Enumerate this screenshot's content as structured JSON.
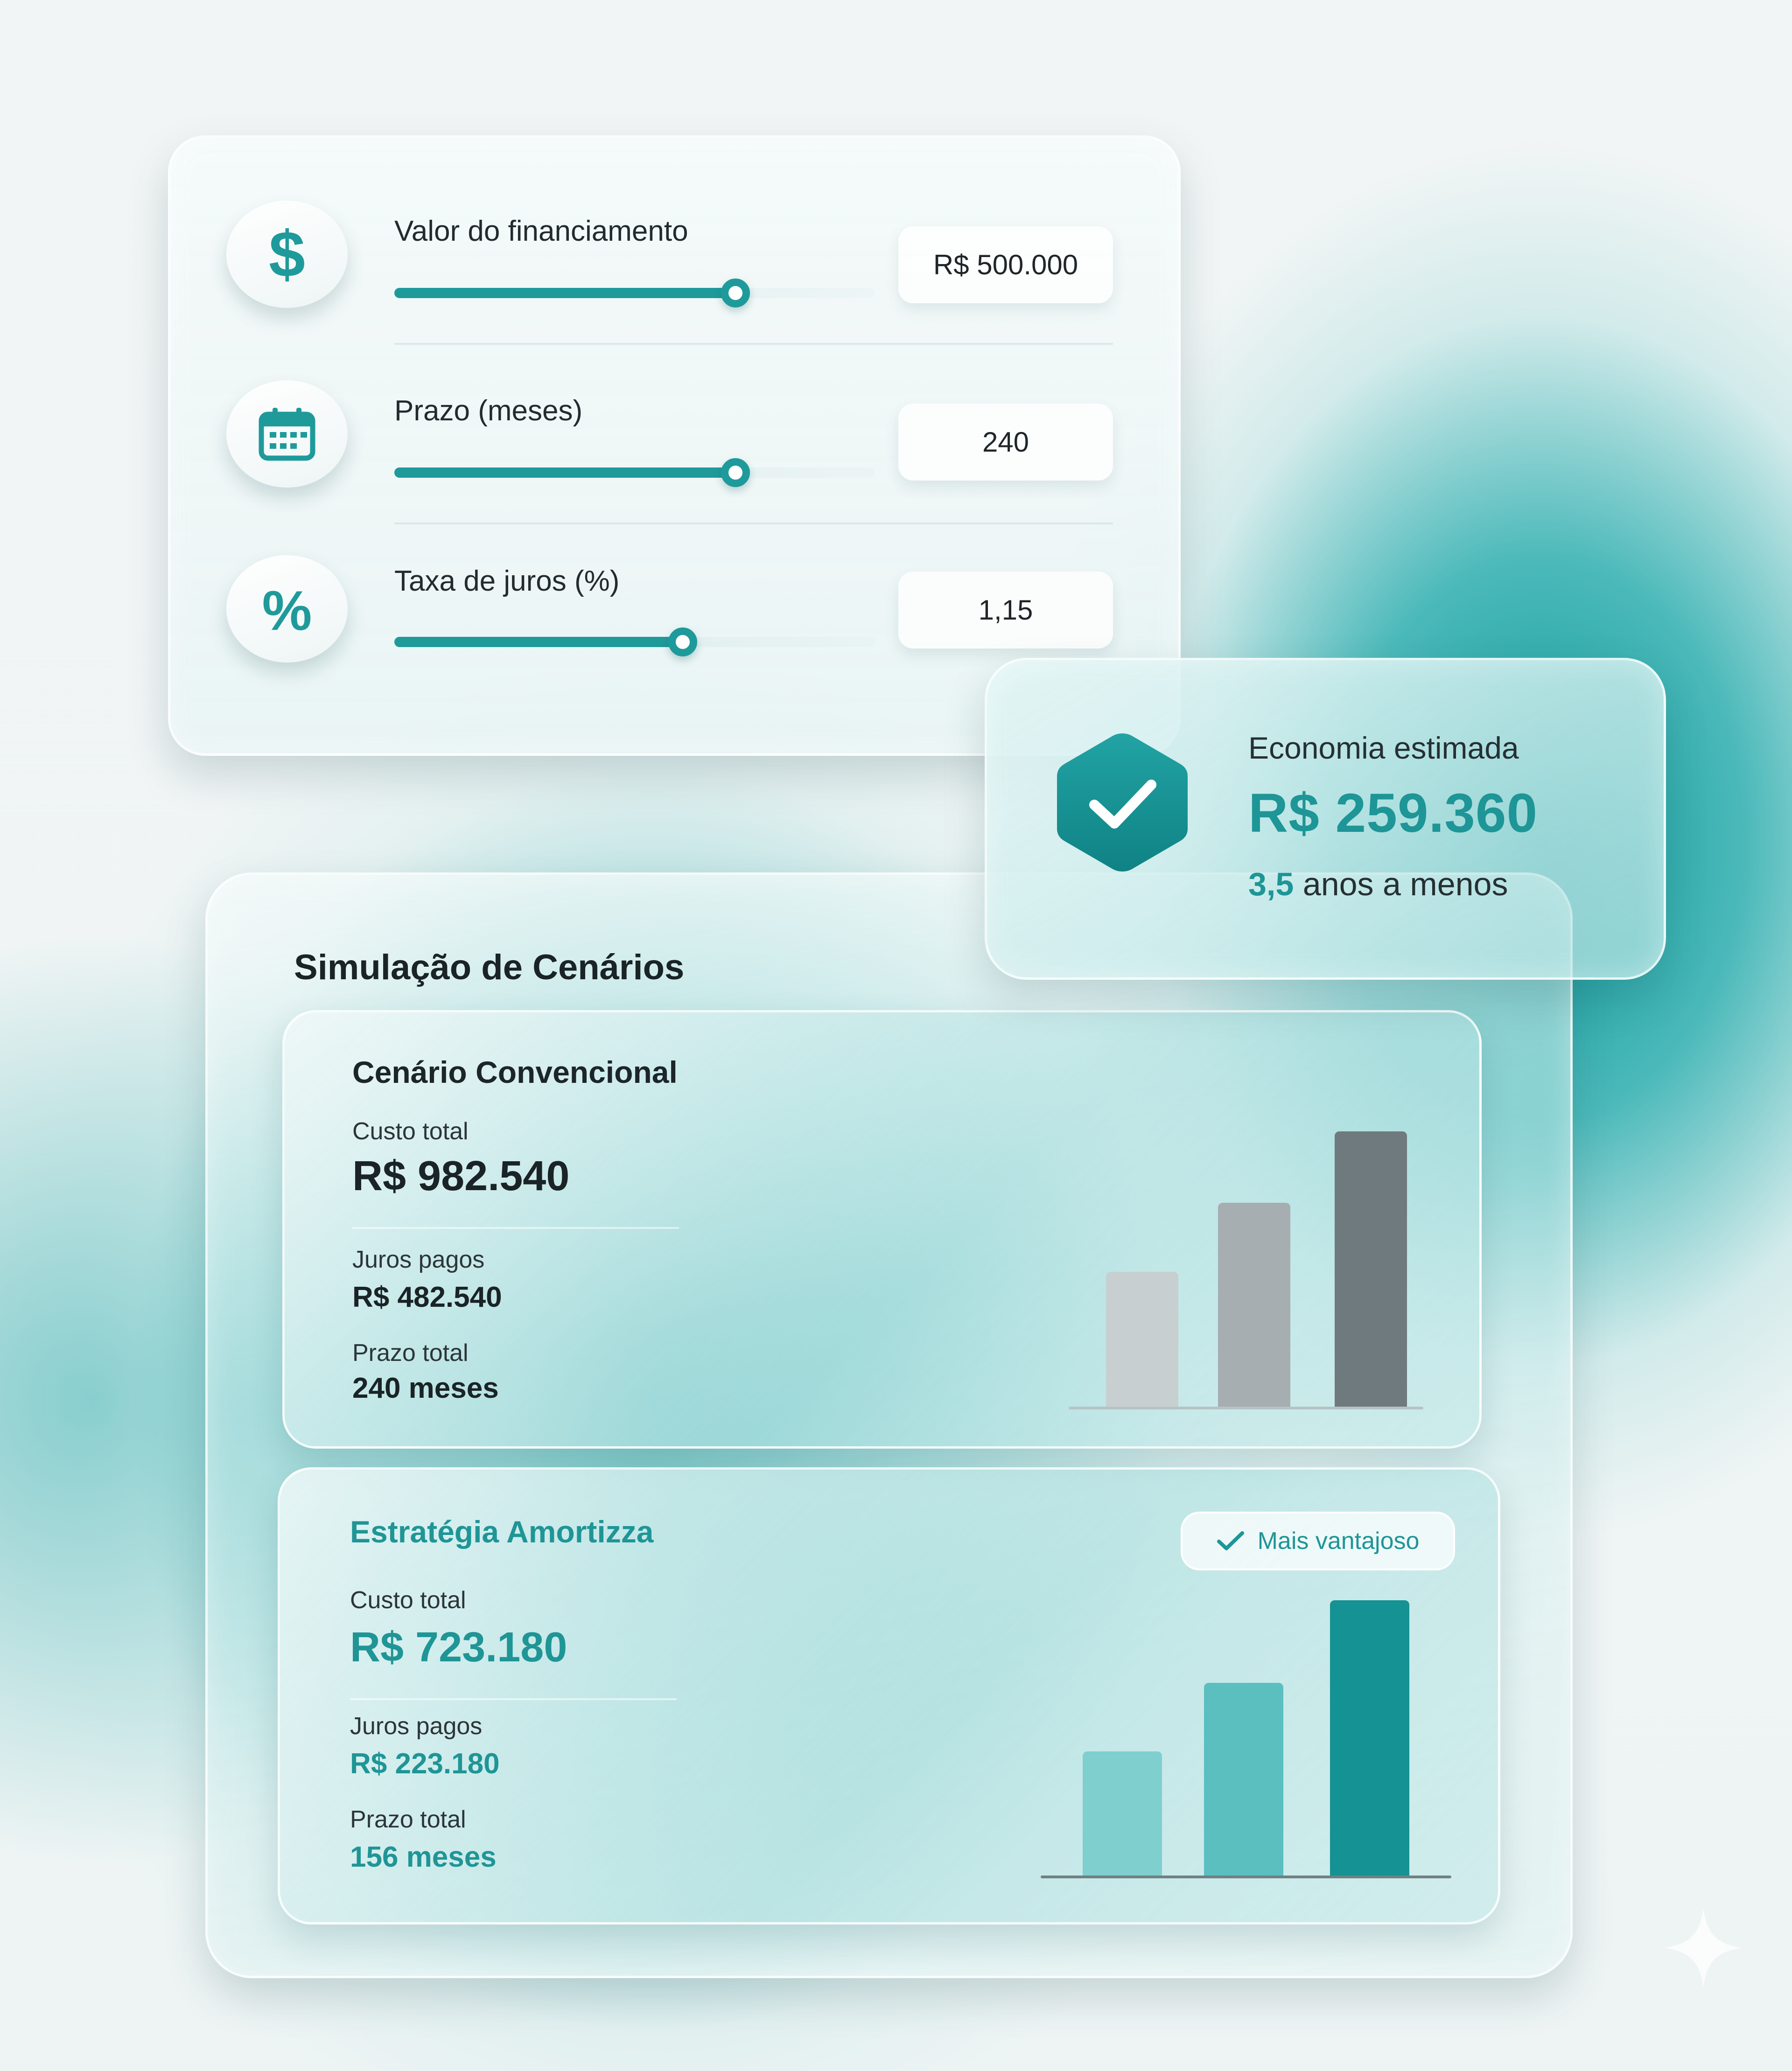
{
  "inputs": {
    "loan": {
      "label": "Valor do financiamento",
      "value": "R$ 500.000",
      "icon": "dollar-icon",
      "slider_fraction": 0.71
    },
    "term": {
      "label": "Prazo (meses)",
      "value": "240",
      "icon": "calendar-icon",
      "slider_fraction": 0.71
    },
    "rate": {
      "label": "Taxa de juros (%)",
      "value": "1,15",
      "icon": "percent-icon",
      "slider_fraction": 0.6
    }
  },
  "savings": {
    "label": "Economia estimada",
    "value": "R$ 259.360",
    "years": "3,5",
    "years_suffix": "anos a menos",
    "icon": "shield-check-icon"
  },
  "scenarios": {
    "title": "Simulação de Cenários",
    "conventional": {
      "title": "Cenário Convencional",
      "total_cost_label": "Custo total",
      "total_cost": "R$ 982.540",
      "interest_label": "Juros pagos",
      "interest": "R$ 482.540",
      "term_label": "Prazo total",
      "term": "240 meses",
      "bars": [
        0.49,
        0.74,
        1.0
      ],
      "bar_colors": [
        "#c8cfd1",
        "#a6aeb2",
        "#6f7a7e"
      ]
    },
    "amortizza": {
      "title": "Estratégia Amortizza",
      "badge": "Mais vantajoso",
      "total_cost_label": "Custo total",
      "total_cost": "R$ 723.180",
      "interest_label": "Juros pagos",
      "interest": "R$ 223.180",
      "term_label": "Prazo total",
      "term": "156 meses",
      "bars": [
        0.45,
        0.7,
        1.0
      ],
      "bar_colors": [
        "#7fcfcf",
        "#5bbfc0",
        "#159293"
      ]
    }
  },
  "colors": {
    "accent": "#1f9a9b",
    "dark_text": "#1c2528"
  }
}
